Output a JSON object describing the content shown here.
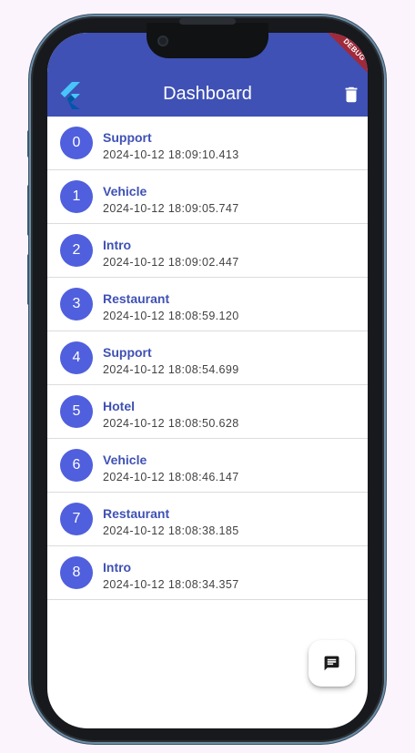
{
  "app_bar": {
    "title": "Dashboard",
    "logo_icon": "flutter-logo-icon",
    "action_icon": "trash-icon"
  },
  "debug_banner": {
    "label": "DEBUG"
  },
  "list": {
    "items": [
      {
        "index": "0",
        "title": "Support",
        "timestamp": "2024-10-12 18:09:10.413"
      },
      {
        "index": "1",
        "title": "Vehicle",
        "timestamp": "2024-10-12 18:09:05.747"
      },
      {
        "index": "2",
        "title": "Intro",
        "timestamp": "2024-10-12 18:09:02.447"
      },
      {
        "index": "3",
        "title": "Restaurant",
        "timestamp": "2024-10-12 18:08:59.120"
      },
      {
        "index": "4",
        "title": "Support",
        "timestamp": "2024-10-12 18:08:54.699"
      },
      {
        "index": "5",
        "title": "Hotel",
        "timestamp": "2024-10-12 18:08:50.628"
      },
      {
        "index": "6",
        "title": "Vehicle",
        "timestamp": "2024-10-12 18:08:46.147"
      },
      {
        "index": "7",
        "title": "Restaurant",
        "timestamp": "2024-10-12 18:08:38.185"
      },
      {
        "index": "8",
        "title": "Intro",
        "timestamp": "2024-10-12 18:08:34.357"
      }
    ]
  },
  "fab": {
    "icon": "chat-message-icon"
  },
  "colors": {
    "primary": "#3f51b5",
    "avatar": "#4f5fdd",
    "page_background": "#fcf4fc",
    "debug_banner": "#a02a3a"
  }
}
